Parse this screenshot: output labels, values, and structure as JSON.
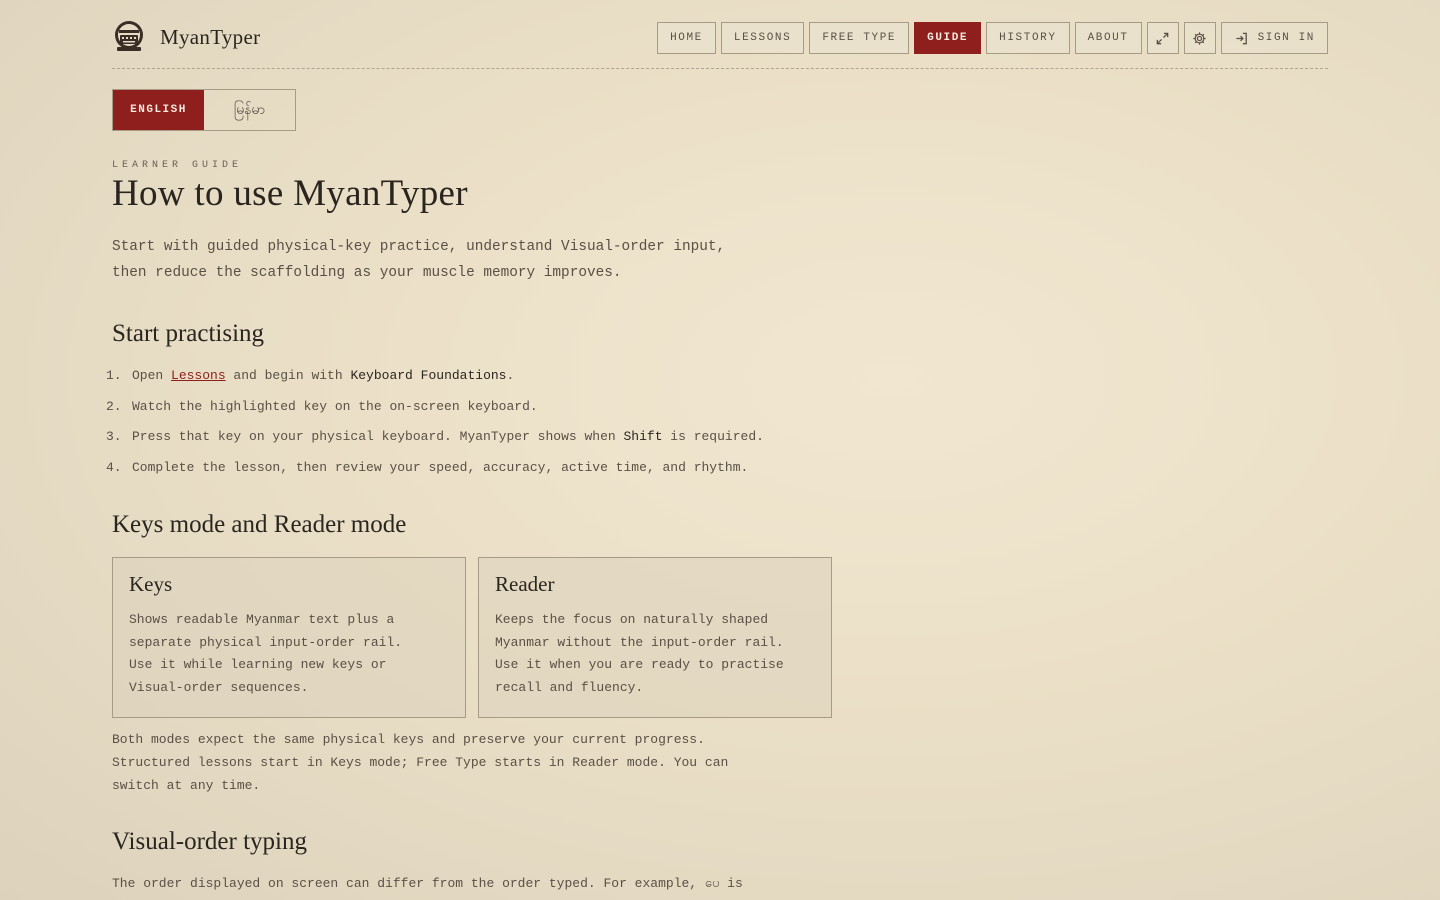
{
  "header": {
    "brand": "MyanTyper",
    "nav": [
      "HOME",
      "LESSONS",
      "FREE TYPE",
      "GUIDE",
      "HISTORY",
      "ABOUT"
    ],
    "active_nav": "GUIDE",
    "fullscreen_icon": "expand-icon",
    "settings_icon": "gear-icon",
    "sign_in": "SIGN IN",
    "sign_in_icon": "sign-in-icon"
  },
  "language": {
    "english": "ENGLISH",
    "myanmar": "မြန်မာ",
    "selected": "ENGLISH"
  },
  "guide": {
    "eyebrow": "LEARNER GUIDE",
    "title": "How to use MyanTyper",
    "intro_line1": "Start with guided physical-key practice, understand Visual-order input,",
    "intro_line2": "then reduce the scaffolding as your muscle memory improves.",
    "start_heading": "Start practising",
    "steps": {
      "s1": {
        "num": "1.",
        "a": "Open ",
        "link": "Lessons",
        "b": " and begin with ",
        "c": "Keyboard Foundations",
        "d": "."
      },
      "s2": {
        "num": "2.",
        "text": "Watch the highlighted key on the on-screen keyboard."
      },
      "s3": {
        "num": "3.",
        "a": "Press that key on your physical keyboard. MyanTyper shows when ",
        "c": "Shift",
        "d": " is required."
      },
      "s4": {
        "num": "4.",
        "text": "Complete the lesson, then review your speed, accuracy, active time, and rhythm."
      }
    },
    "modes_heading": "Keys mode and Reader mode",
    "keys_card": {
      "title": "Keys",
      "lines": [
        "Shows readable Myanmar text plus a",
        "separate physical input-order rail.",
        "Use it while learning new keys or",
        "Visual-order sequences."
      ]
    },
    "reader_card": {
      "title": "Reader",
      "lines": [
        "Keeps the focus on naturally shaped",
        "Myanmar without the input-order rail.",
        "Use it when you are ready to practise",
        "recall and fluency."
      ]
    },
    "modes_note": [
      "Both modes expect the same physical keys and preserve your current progress.",
      "Structured lessons start in Keys mode; Free Type starts in Reader mode. You can",
      "switch at any time."
    ],
    "visual_heading": "Visual-order typing",
    "visual_text": "The order displayed on screen can differ from the order typed. For example, ပေ is"
  },
  "colors": {
    "accent": "#8e1f1c",
    "background": "#ebe0c7",
    "text": "#3a332a",
    "border": "#a79b86"
  }
}
